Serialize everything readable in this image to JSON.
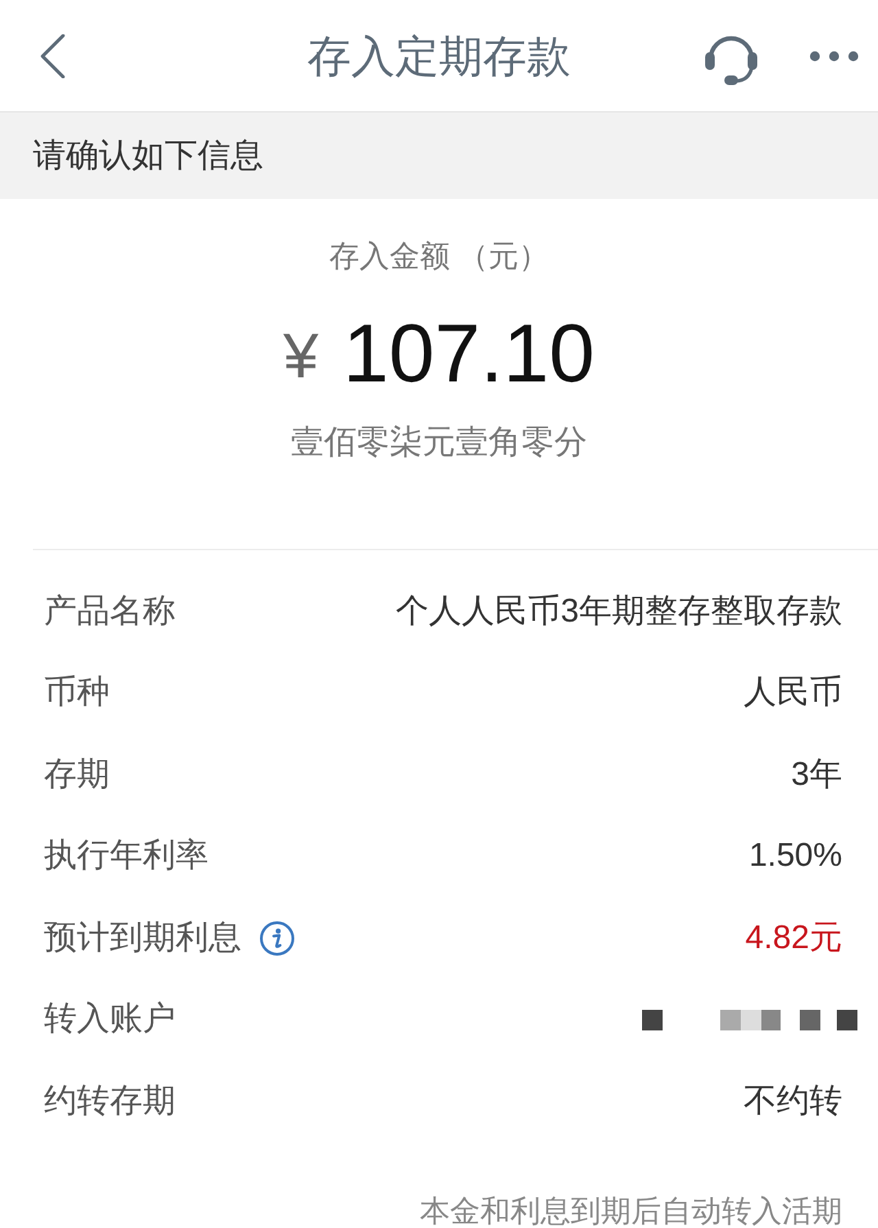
{
  "header": {
    "title": "存入定期存款"
  },
  "notice": {
    "text": "请确认如下信息"
  },
  "amount": {
    "label": "存入金额 （元）",
    "currency_symbol": "¥",
    "value": "107.10",
    "in_words": "壹佰零柒元壹角零分"
  },
  "details": [
    {
      "kind": "text",
      "label": "产品名称",
      "value": "个人人民币3年期整存整取存款"
    },
    {
      "kind": "text",
      "label": "币种",
      "value": "人民币"
    },
    {
      "kind": "text",
      "label": "存期",
      "value": "3年"
    },
    {
      "kind": "text",
      "label": "执行年利率",
      "value": "1.50%"
    },
    {
      "kind": "interest",
      "label": "预计到期利息",
      "value": "4.82元"
    },
    {
      "kind": "redacted",
      "label": "转入账户"
    },
    {
      "kind": "text",
      "label": "约转存期",
      "value": "不约转"
    }
  ],
  "footnote": "本金和利息到期后自动转入活期"
}
